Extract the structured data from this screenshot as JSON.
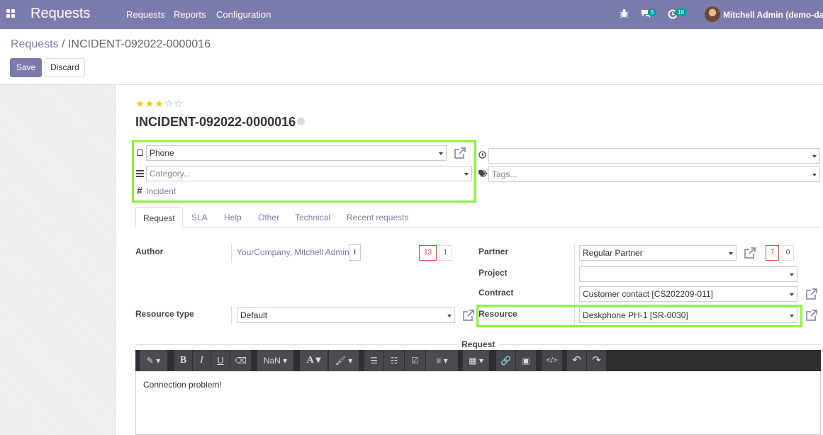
{
  "navbar": {
    "app_title": "Requests",
    "menu": [
      "Requests",
      "Reports",
      "Configuration"
    ],
    "chat_count": "5",
    "activity_count": "18",
    "user_name": "Mitchell Admin (demo-datab"
  },
  "breadcrumb": {
    "parent": "Requests",
    "separator": "/",
    "current": "INCIDENT-092022-0000016"
  },
  "buttons": {
    "save": "Save",
    "discard": "Discard"
  },
  "record": {
    "stars": {
      "filled": 3,
      "total": 5
    },
    "title": "INCIDENT-092022-0000016",
    "channel": "Phone",
    "category_placeholder": "Category...",
    "request_type": "Incident",
    "state_value": "",
    "tags_placeholder": "Tags..."
  },
  "tabs": [
    "Request",
    "SLA",
    "Help",
    "Other",
    "Technical",
    "Recent requests"
  ],
  "request_tab": {
    "author_label": "Author",
    "author_value": "YourCompany, Mitchell Admin",
    "author_counts": [
      "13",
      "1"
    ],
    "resource_type_label": "Resource type",
    "resource_type_value": "Default",
    "partner_label": "Partner",
    "partner_value": "Regular Partner",
    "partner_counts": [
      "7",
      "0"
    ],
    "project_label": "Project",
    "project_value": "",
    "contract_label": "Contract",
    "contract_value": "Customer contact [CS202209-011]",
    "resource_label": "Resource",
    "resource_value": "Deskphone PH-1 [SR-0030]"
  },
  "editor": {
    "section_label": "Request",
    "font_size": "NaN",
    "content": "Connection problem!"
  },
  "colors": {
    "navbar": "#7c7bad",
    "primary": "#7c7bad",
    "highlight": "#8ef239",
    "toolbar": "#2f2f32"
  }
}
